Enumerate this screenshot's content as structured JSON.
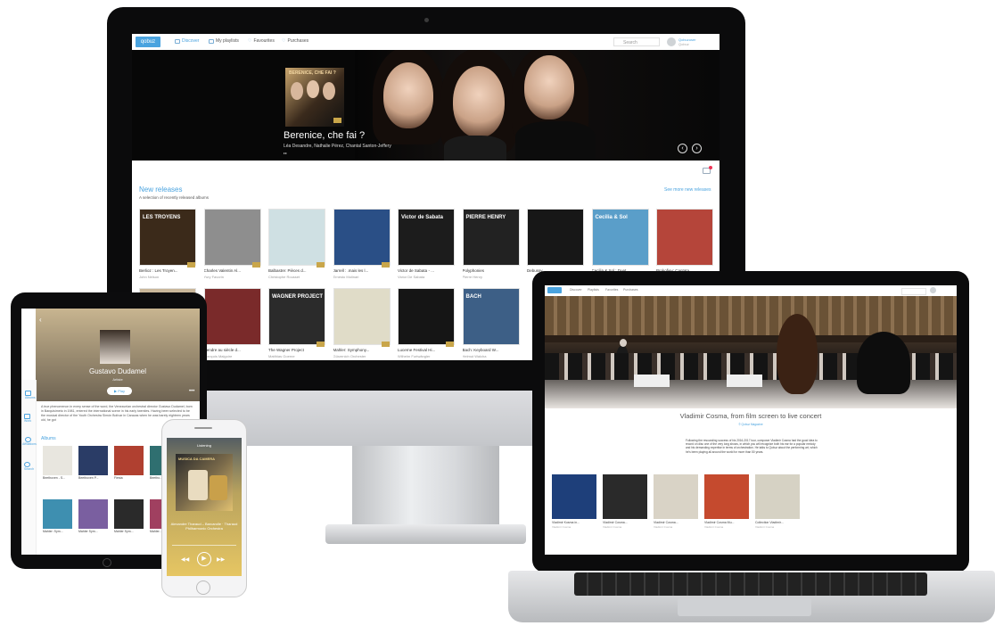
{
  "desktop": {
    "nav": {
      "logo": "qobuz",
      "items": [
        {
          "label": "Discover",
          "active": true
        },
        {
          "label": "My playlists",
          "active": false
        },
        {
          "label": "Favourites",
          "active": false
        },
        {
          "label": "Purchases",
          "active": false
        }
      ],
      "search_placeholder": "Search",
      "user_line1": "Qobuzuser",
      "user_line2": "Qobuz"
    },
    "hero": {
      "album_cover_title": "BERENICE, CHE FAI ?",
      "title": "Berenice, che fai ?",
      "subtitle": "Léa Desandre, Nathalie Pérez, Chantal Santon-Jeffery",
      "small": "▸▸"
    },
    "new_releases": {
      "title": "New releases",
      "subtitle": "A selection of recently released albums",
      "see_more": "See more new releases",
      "row1": [
        {
          "cover_text": "LES TROYENS",
          "title": "Berlioz : Les Troyen...",
          "artist": "John Nelson",
          "color": "#3b2a1a",
          "hires": true
        },
        {
          "cover_text": "",
          "title": "Charles Valentin Al...",
          "artist": "Yury Favorin",
          "color": "#8e8e8e",
          "hires": true
        },
        {
          "cover_text": "",
          "title": "Balbastre: Pièces d...",
          "artist": "Christophe Rousset",
          "color": "#cfe0e3",
          "hires": true
        },
        {
          "cover_text": "",
          "title": "Jarrell : .mais les l...",
          "artist": "Ernesto Molinari",
          "color": "#2a4f86",
          "hires": true
        },
        {
          "cover_text": "Victor de Sabata",
          "title": "Victor de Sabata - ...",
          "artist": "Victor De Sabata",
          "color": "#1c1c1c",
          "hires": false
        },
        {
          "cover_text": "PIERRE HENRY",
          "title": "Polyphonies",
          "artist": "Pierre Henry",
          "color": "#222222",
          "hires": false
        },
        {
          "cover_text": "",
          "title": "Debussy...",
          "artist": "",
          "color": "#171717",
          "hires": false
        },
        {
          "cover_text": "Cecilia & Sol",
          "title": "Cecilia & Sol : Duet...",
          "artist": "",
          "color": "#5a9ec9",
          "hires": false
        },
        {
          "cover_text": "",
          "title": "Prokofiev: Cantata...",
          "artist": "",
          "color": "#b5453a",
          "hires": false
        }
      ],
      "row2": [
        {
          "cover_text": "",
          "title": "",
          "artist": "",
          "color": "#c9b79a",
          "hires": false
        },
        {
          "cover_text": "",
          "title": "Cendre au siècle d...",
          "artist": "François Malgoire",
          "color": "#7a2a2a",
          "hires": false
        },
        {
          "cover_text": "WAGNER PROJECT",
          "title": "The Wagner Project",
          "artist": "Matthias Goerne",
          "color": "#2b2b2b",
          "hires": true
        },
        {
          "cover_text": "",
          "title": "Mahler: Symphony...",
          "artist": "Gürzenich Orchester",
          "color": "#e0dcc8",
          "hires": true
        },
        {
          "cover_text": "",
          "title": "Lucerne Festival Hi...",
          "artist": "Wilhelm Furtwängler",
          "color": "#151515",
          "hires": true
        },
        {
          "cover_text": "BACH",
          "title": "Bach: Keyboard W...",
          "artist": "Helmut Walcha",
          "color": "#3d5f86",
          "hires": false
        }
      ]
    }
  },
  "tablet": {
    "artist_name": "Gustavo Dudamel",
    "artist_role": "Artiste",
    "play_label": "▶ Play",
    "bio": "A true phenomenon in every sense of the word, the Venezuelan orchestral director Gustavo Dudamel, born in Barquisimeto in 1981, entered the international scene in his early twenties. Having been selected to be the musical director of the Youth Orchestra Simón Bolívar in Caracas when he was barely eighteen years old, he got",
    "albums_title": "Albums",
    "sidebar": [
      {
        "label": "Albums"
      },
      {
        "label": "Work"
      },
      {
        "label": "Affiliations"
      },
      {
        "label": "Search"
      }
    ],
    "albums_row1": [
      {
        "label": "Beethoven - S...",
        "color": "#e8e6df"
      },
      {
        "label": "Beethoven P...",
        "color": "#2a3c66"
      },
      {
        "label": "Fiesta",
        "color": "#b04030"
      },
      {
        "label": "Beetho...",
        "color": "#2f6f70"
      }
    ],
    "albums_row2": [
      {
        "label": "Mahler: Sym...",
        "color": "#3e8fb0"
      },
      {
        "label": "Mahler Sym...",
        "color": "#7a5fa0"
      },
      {
        "label": "Mahler Sym...",
        "color": "#2a2a2a"
      },
      {
        "label": "Mahler...",
        "color": "#a04060"
      }
    ]
  },
  "phone": {
    "header": "Listening",
    "cover_text": "MUSICA DA CAMERA",
    "track": "Alexandre Tharaud – Barcarolle · Tharaud Philharmonic Orchestra",
    "play_icon": "▶",
    "prev_icon": "◀◀",
    "next_icon": "▶▶"
  },
  "laptop": {
    "nav_items": [
      "Discover",
      "Playlists",
      "Favorites",
      "Purchases"
    ],
    "hero_title": "Vladimir Cosma, from film screen to live concert",
    "meta": "© Qobuz Magazine",
    "text": "Following the resounding success of his 2016-2017 tour, composer Vladimir Cosma had the good idea to record on disc one of the very long shows, in which you will recognize both his ear for a popular melody and his demanding expertise in terms of orchestration. He talks to Qobuz about the performing art, which he's been playing all around the world for more than 50 years.",
    "albums": [
      {
        "title": "Vladimir Kosma in...",
        "sub": "Vladimir Cosma",
        "color": "#1e3f7a"
      },
      {
        "title": "Vladimir Cosma...",
        "sub": "Vladimir Cosma",
        "color": "#2a2a2a"
      },
      {
        "title": "Vladimir Cosma...",
        "sub": "Vladimir Cosma",
        "color": "#d9d3c6"
      },
      {
        "title": "Vladimir Cosma Mu...",
        "sub": "Vladimir Cosma",
        "color": "#c54a2e"
      },
      {
        "title": "Collection Vladimir...",
        "sub": "Vladimir Cosma",
        "color": "#d6d2c4"
      }
    ]
  }
}
